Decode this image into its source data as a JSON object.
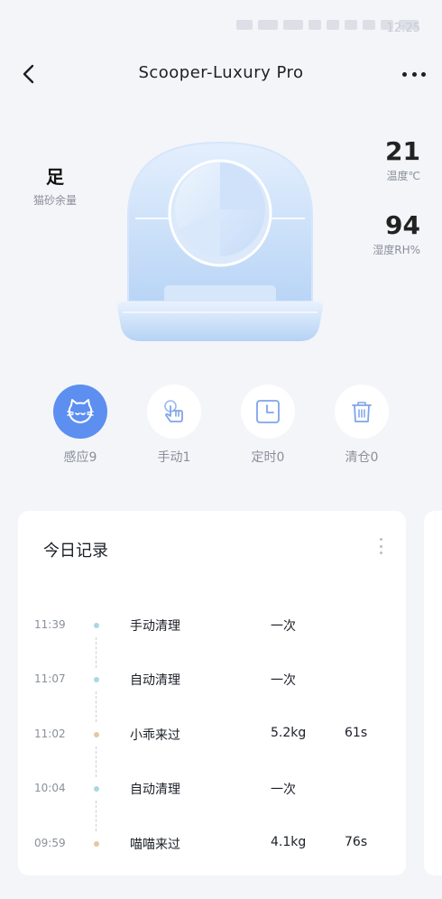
{
  "status_bar": {
    "time": "12:25"
  },
  "nav": {
    "title": "Scooper-Luxury Pro"
  },
  "litter": {
    "value": "足",
    "label": "猫砂余量"
  },
  "temperature": {
    "value": "21",
    "label": "温度℃"
  },
  "humidity": {
    "value": "94",
    "label": "湿度RH%"
  },
  "modes": [
    {
      "label": "感应9",
      "icon": "cat-icon",
      "active": true
    },
    {
      "label": "手动1",
      "icon": "hand-tap-icon",
      "active": false
    },
    {
      "label": "定时0",
      "icon": "clock-icon",
      "active": false
    },
    {
      "label": "清仓0",
      "icon": "trash-icon",
      "active": false
    }
  ],
  "records_card": {
    "title": "今日记录",
    "rows": [
      {
        "time": "11:39",
        "event": "手动清理",
        "detail": "一次",
        "duration": "",
        "dot": "teal"
      },
      {
        "time": "11:07",
        "event": "自动清理",
        "detail": "一次",
        "duration": "",
        "dot": "teal"
      },
      {
        "time": "11:02",
        "event": "小乖来过",
        "detail": "5.2kg",
        "duration": "61s",
        "dot": "tan"
      },
      {
        "time": "10:04",
        "event": "自动清理",
        "detail": "一次",
        "duration": "",
        "dot": "teal"
      },
      {
        "time": "09:59",
        "event": "喵喵来过",
        "detail": "4.1kg",
        "duration": "76s",
        "dot": "tan"
      }
    ]
  },
  "colors": {
    "accent": "#5c8ff0",
    "teal_dot": "#a8d8e0",
    "tan_dot": "#e6c7a0"
  }
}
